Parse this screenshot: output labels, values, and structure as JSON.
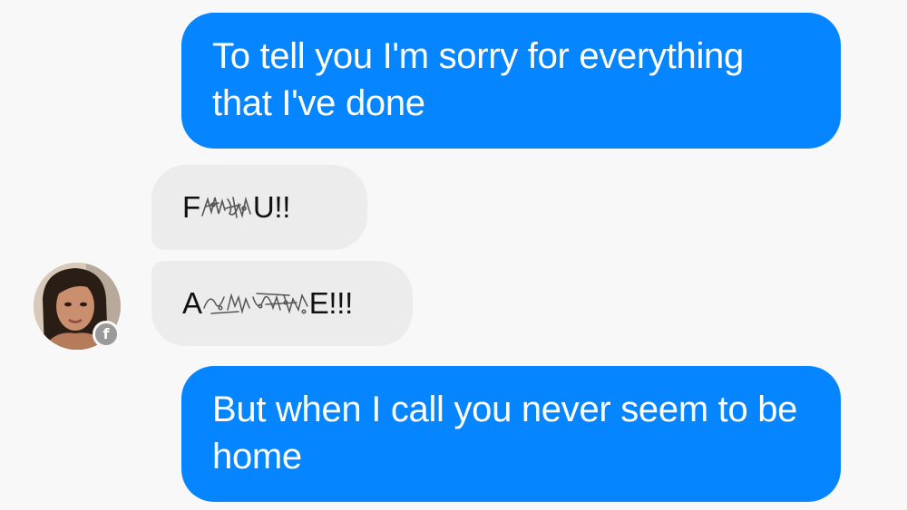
{
  "conversation": {
    "messages": [
      {
        "direction": "sent",
        "text": "To tell you I'm sorry for everything that I've done"
      },
      {
        "direction": "received",
        "prefix": "F",
        "suffix": "U!!"
      },
      {
        "direction": "received",
        "prefix": "A",
        "suffix": "E!!!"
      },
      {
        "direction": "sent",
        "text": "But when I call you never seem to be home"
      }
    ]
  },
  "contact": {
    "avatar": "profile-photo",
    "badge_icon": "facebook-icon",
    "badge_glyph": "f"
  },
  "colors": {
    "sent_bubble": "#0585ff",
    "received_bubble": "#ececec",
    "background": "#f8f8f8",
    "badge": "#9a9a9a"
  }
}
